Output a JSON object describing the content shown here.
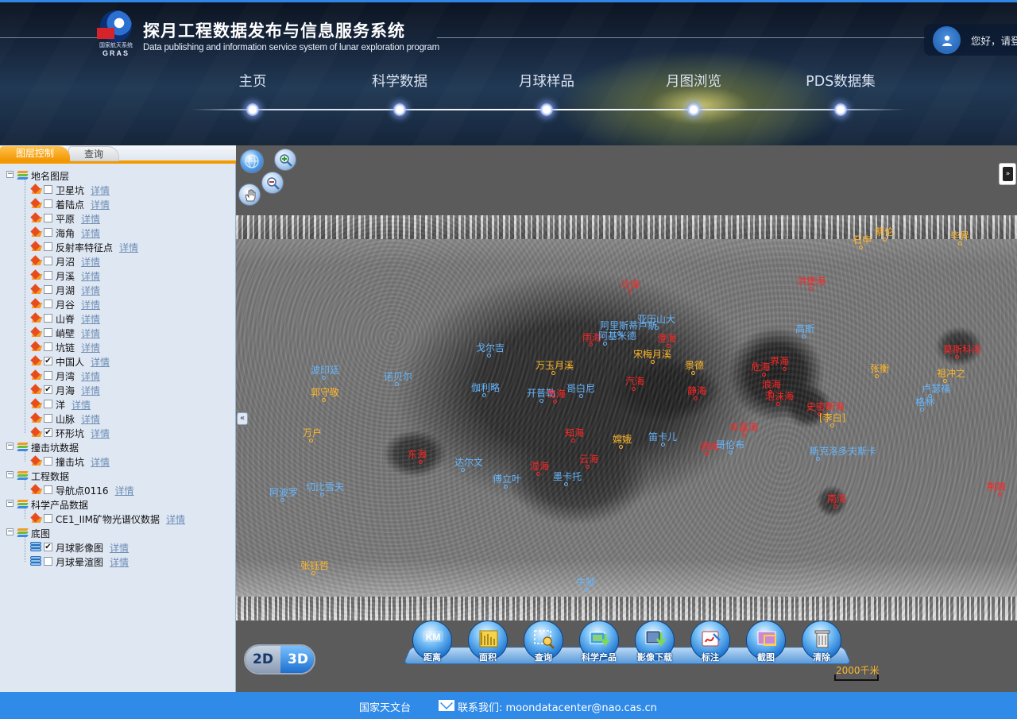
{
  "header": {
    "logo_small_text": "国家航天系统",
    "logo_brand": "GRAS",
    "title": "探月工程数据发布与信息服务系统",
    "subtitle": "Data publishing and information service system of lunar exploration program",
    "greeting": "您好，请登",
    "nav": [
      {
        "label": "主页"
      },
      {
        "label": "科学数据"
      },
      {
        "label": "月球样品"
      },
      {
        "label": "月图浏览"
      },
      {
        "label": "PDS数据集"
      }
    ]
  },
  "left_panel": {
    "tabs": [
      {
        "label": "图层控制"
      },
      {
        "label": "查询"
      }
    ],
    "detail_label": "详情",
    "groups": [
      {
        "label": "地名图层",
        "items": [
          {
            "label": "卫星坑",
            "checked": false
          },
          {
            "label": "着陆点",
            "checked": false
          },
          {
            "label": "平原",
            "checked": false
          },
          {
            "label": "海角",
            "checked": false
          },
          {
            "label": "反射率特征点",
            "checked": false
          },
          {
            "label": "月沼",
            "checked": false
          },
          {
            "label": "月溪",
            "checked": false
          },
          {
            "label": "月湖",
            "checked": false
          },
          {
            "label": "月谷",
            "checked": false
          },
          {
            "label": "山脊",
            "checked": false
          },
          {
            "label": "峭壁",
            "checked": false
          },
          {
            "label": "坑链",
            "checked": false
          },
          {
            "label": "中国人",
            "checked": true
          },
          {
            "label": "月湾",
            "checked": false
          },
          {
            "label": "月海",
            "checked": true
          },
          {
            "label": "洋",
            "checked": false
          },
          {
            "label": "山脉",
            "checked": false
          },
          {
            "label": "环形坑",
            "checked": true
          }
        ]
      },
      {
        "label": "撞击坑数据",
        "items": [
          {
            "label": "撞击坑",
            "checked": false
          }
        ]
      },
      {
        "label": "工程数据",
        "items": [
          {
            "label": "导航点0116",
            "checked": false
          }
        ]
      },
      {
        "label": "科学产品数据",
        "items": [
          {
            "label": "CE1_IIM矿物光谱仪数据",
            "checked": false
          }
        ]
      },
      {
        "label": "底图",
        "items": [
          {
            "label": "月球影像图",
            "checked": true
          },
          {
            "label": "月球晕渲图",
            "checked": false
          }
        ]
      }
    ]
  },
  "map": {
    "dim_2d": "2D",
    "dim_3d": "3D",
    "scale_label": "2000千米",
    "toggle_left": "«",
    "toggle_right": "»",
    "toolbar": [
      {
        "label": "距离",
        "icon": "ruler-km-icon"
      },
      {
        "label": "面积",
        "icon": "area-icon"
      },
      {
        "label": "查询",
        "icon": "query-icon"
      },
      {
        "label": "科学产品",
        "icon": "science-product-icon"
      },
      {
        "label": "影像下载",
        "icon": "image-download-icon"
      },
      {
        "label": "标注",
        "icon": "annotate-icon"
      },
      {
        "label": "截图",
        "icon": "screenshot-icon"
      },
      {
        "label": "清除",
        "icon": "trash-icon"
      }
    ],
    "features": [
      {
        "label": "冷海",
        "color": "red"
      },
      {
        "label": "洪堡海",
        "color": "red"
      },
      {
        "label": "亚历山大",
        "color": "blue"
      },
      {
        "label": "雨海",
        "color": "red"
      },
      {
        "label": "阿里斯蒂卢斯",
        "color": "blue"
      },
      {
        "label": "阿基米德",
        "color": "blue"
      },
      {
        "label": "澄海",
        "color": "red"
      },
      {
        "label": "高斯",
        "color": "blue"
      },
      {
        "label": "戈尔吉",
        "color": "blue"
      },
      {
        "label": "万玉月溪",
        "color": "orange"
      },
      {
        "label": "宋梅月溪",
        "color": "orange"
      },
      {
        "label": "景德",
        "color": "orange"
      },
      {
        "label": "危海",
        "color": "red"
      },
      {
        "label": "界海",
        "color": "red"
      },
      {
        "label": "莫斯科海",
        "color": "red"
      },
      {
        "label": "张衡",
        "color": "orange"
      },
      {
        "label": "祖冲之",
        "color": "orange"
      },
      {
        "label": "卢瑟福",
        "color": "blue"
      },
      {
        "label": "格林",
        "color": "blue"
      },
      {
        "label": "波印廷",
        "color": "blue"
      },
      {
        "label": "诺贝尔",
        "color": "blue"
      },
      {
        "label": "伽利略",
        "color": "blue"
      },
      {
        "label": "开普勒",
        "color": "blue"
      },
      {
        "label": "岛海",
        "color": "red"
      },
      {
        "label": "哥白尼",
        "color": "blue"
      },
      {
        "label": "汽海",
        "color": "red"
      },
      {
        "label": "静海",
        "color": "red"
      },
      {
        "label": "浪海",
        "color": "red"
      },
      {
        "label": "泡沫海",
        "color": "red"
      },
      {
        "label": "史密斯海",
        "color": "red"
      },
      {
        "label": "郭守敬",
        "color": "orange"
      },
      {
        "label": "万户",
        "color": "orange"
      },
      {
        "label": "知海",
        "color": "red"
      },
      {
        "label": "嫦娥",
        "color": "orange"
      },
      {
        "label": "笛卡儿",
        "color": "blue"
      },
      {
        "label": "丰富海",
        "color": "red"
      },
      {
        "label": "[李白]",
        "color": "orange"
      },
      {
        "label": "酒海",
        "color": "red"
      },
      {
        "label": "哥伦布",
        "color": "blue"
      },
      {
        "label": "斯克洛多夫斯卡",
        "color": "blue"
      },
      {
        "label": "东海",
        "color": "red"
      },
      {
        "label": "达尔文",
        "color": "blue"
      },
      {
        "label": "湿海",
        "color": "red"
      },
      {
        "label": "云海",
        "color": "red"
      },
      {
        "label": "傅立叶",
        "color": "blue"
      },
      {
        "label": "墨卡托",
        "color": "blue"
      },
      {
        "label": "阿波罗",
        "color": "blue"
      },
      {
        "label": "切比雪夫",
        "color": "blue"
      },
      {
        "label": "南海",
        "color": "red"
      },
      {
        "label": "张钰哲",
        "color": "orange"
      },
      {
        "label": "荆棘",
        "color": "red"
      },
      {
        "label": "石申",
        "color": "orange"
      },
      {
        "label": "蔡伦",
        "color": "orange"
      },
      {
        "label": "毕昇",
        "color": "orange"
      },
      {
        "label": "牛顿",
        "color": "blue"
      }
    ],
    "colors": {
      "blue": "#67b7ff",
      "red": "#ff2626",
      "orange": "#ffb72a"
    }
  },
  "footer": {
    "org": "国家天文台",
    "contact": "联系我们: moondatacenter@nao.cas.cn"
  }
}
